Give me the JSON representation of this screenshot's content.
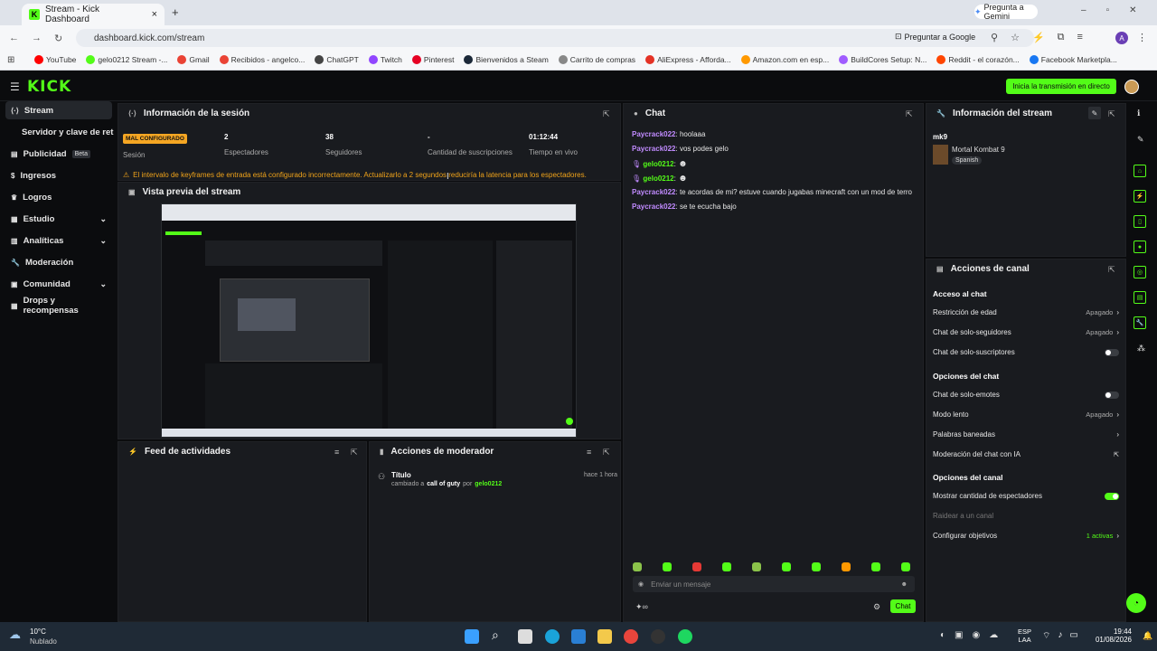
{
  "browser": {
    "tab_title": "Stream - Kick Dashboard",
    "url": "dashboard.kick.com/stream",
    "gemini_label": "Pregunta a Gemini",
    "google_label": "Preguntar a Google",
    "profile_initial": "A",
    "bookmarks": [
      {
        "label": "YouTube",
        "color": "#ff0000"
      },
      {
        "label": "gelo0212 Stream -...",
        "color": "#53fc18"
      },
      {
        "label": "Gmail",
        "color": "#ea4335"
      },
      {
        "label": "Recibidos - angelco...",
        "color": "#ea4335"
      },
      {
        "label": "ChatGPT",
        "color": "#444444"
      },
      {
        "label": "Twitch",
        "color": "#9146ff"
      },
      {
        "label": "Pinterest",
        "color": "#e60023"
      },
      {
        "label": "Bienvenidos a Steam",
        "color": "#1b2838"
      },
      {
        "label": "Carrito de compras",
        "color": "#888888"
      },
      {
        "label": "AliExpress - Afforda...",
        "color": "#e43225"
      },
      {
        "label": "Amazon.com en esp...",
        "color": "#ff9900"
      },
      {
        "label": "BuildCores Setup: N...",
        "color": "#a05cff"
      },
      {
        "label": "Reddit - el corazón...",
        "color": "#ff4500"
      },
      {
        "label": "Facebook Marketpla...",
        "color": "#1877f2"
      }
    ]
  },
  "topbar": {
    "logo": "KICK",
    "go_live": "Inicia la transmisión en directo"
  },
  "sidebar": {
    "items": [
      {
        "label": "Stream",
        "icon": "stream-icon",
        "active": true
      },
      {
        "label": "Servidor y clave de retransmisión",
        "icon": "",
        "active": false
      },
      {
        "label": "Publicidad",
        "icon": "ads-icon",
        "badge": "Beta"
      },
      {
        "label": "Ingresos",
        "icon": "income-icon"
      },
      {
        "label": "Logros",
        "icon": "trophy-icon"
      },
      {
        "label": "Estudio",
        "icon": "studio-icon",
        "chevron": true
      },
      {
        "label": "Analíticas",
        "icon": "analytics-icon",
        "chevron": true
      },
      {
        "label": "Moderación",
        "icon": "wrench-icon"
      },
      {
        "label": "Comunidad",
        "icon": "community-icon",
        "chevron": true
      },
      {
        "label": "Drops y recompensas",
        "icon": "drops-icon"
      }
    ]
  },
  "session": {
    "title": "Información de la sesión",
    "status_badge": "MAL CONFIGURADO",
    "status_label": "Sesión",
    "stats": [
      {
        "value": "2",
        "label": "Espectadores"
      },
      {
        "value": "38",
        "label": "Seguidores"
      },
      {
        "value": "-",
        "label": "Cantidad de suscripciones"
      },
      {
        "value": "01:12:44",
        "label": "Tiempo en vivo"
      }
    ],
    "warning": "El intervalo de keyframes de entrada está configurado incorrectamente. Actualizarlo a 2 segundos reduciría la latencia para los espectadores."
  },
  "preview": {
    "title": "Vista previa del stream"
  },
  "feed": {
    "title": "Feed de actividades"
  },
  "modactions": {
    "title": "Acciones de moderador",
    "item_title": "Título",
    "item_prefix": "cambiado a",
    "item_value": "call of guty",
    "item_by": "por",
    "item_user": "gelo0212",
    "item_time": "hace 1 hora"
  },
  "chat": {
    "title": "Chat",
    "messages": [
      {
        "user": "Paycrack022",
        "text": "hoolaaa",
        "color": "u1"
      },
      {
        "user": "Paycrack022",
        "text": "vos podes gelo",
        "color": "u1"
      },
      {
        "user": "gelo0212",
        "text": "",
        "color": "u2"
      },
      {
        "user": "gelo0212",
        "text": "",
        "color": "u2"
      },
      {
        "user": "Paycrack022",
        "text": "te acordas de mi? estuve cuando jugabas minecraft con un mod de terro",
        "color": "u1"
      },
      {
        "user": "Paycrack022",
        "text": "se te ecucha bajo",
        "color": "u1"
      }
    ],
    "input_placeholder": "Enviar un mensaje",
    "send_label": "Chat"
  },
  "streaminfo": {
    "title": "Información del stream",
    "stream_title": "mk9",
    "category": "Mortal Kombat 9",
    "language": "Spanish"
  },
  "channel": {
    "title": "Acciones de canal",
    "sections": {
      "access": "Acceso al chat",
      "chat_options": "Opciones del chat",
      "channel_options": "Opciones del canal"
    },
    "rows": {
      "age": {
        "label": "Restricción de edad",
        "value": "Apagado"
      },
      "followers": {
        "label": "Chat de solo-seguidores",
        "value": "Apagado"
      },
      "subs": {
        "label": "Chat de solo-suscriptores"
      },
      "emotes": {
        "label": "Chat de solo-emotes"
      },
      "slow": {
        "label": "Modo lento",
        "value": "Apagado"
      },
      "banned": {
        "label": "Palabras baneadas"
      },
      "ai": {
        "label": "Moderación del chat con IA"
      },
      "viewers": {
        "label": "Mostrar cantidad de espectadores"
      },
      "raid": {
        "label": "Raidear a un canal"
      },
      "goals": {
        "label": "Configurar objetivos",
        "value": "1 activas"
      }
    }
  },
  "taskbar": {
    "weather_temp": "10°C",
    "weather_desc": "Nublado",
    "lang": "ESP",
    "lang2": "LAA",
    "time": "19:44",
    "date": "01/08/2026"
  }
}
